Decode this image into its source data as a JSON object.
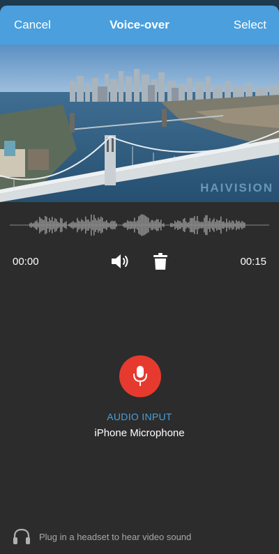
{
  "navbar": {
    "cancel_label": "Cancel",
    "title": "Voice-over",
    "select_label": "Select"
  },
  "video": {
    "watermark": "HAIVISION"
  },
  "timeline": {
    "start_time": "00:00",
    "end_time": "00:15"
  },
  "icons": {
    "speaker": "speaker-icon",
    "trash": "trash-icon",
    "mic": "microphone-icon",
    "headset": "headphones-icon"
  },
  "audio_input": {
    "label": "AUDIO INPUT",
    "value": "iPhone Microphone"
  },
  "footer": {
    "hint": "Plug in a headset to hear video sound"
  },
  "colors": {
    "accent": "#4a9fdc",
    "record": "#e73a2f",
    "background": "#2c2c2c"
  }
}
